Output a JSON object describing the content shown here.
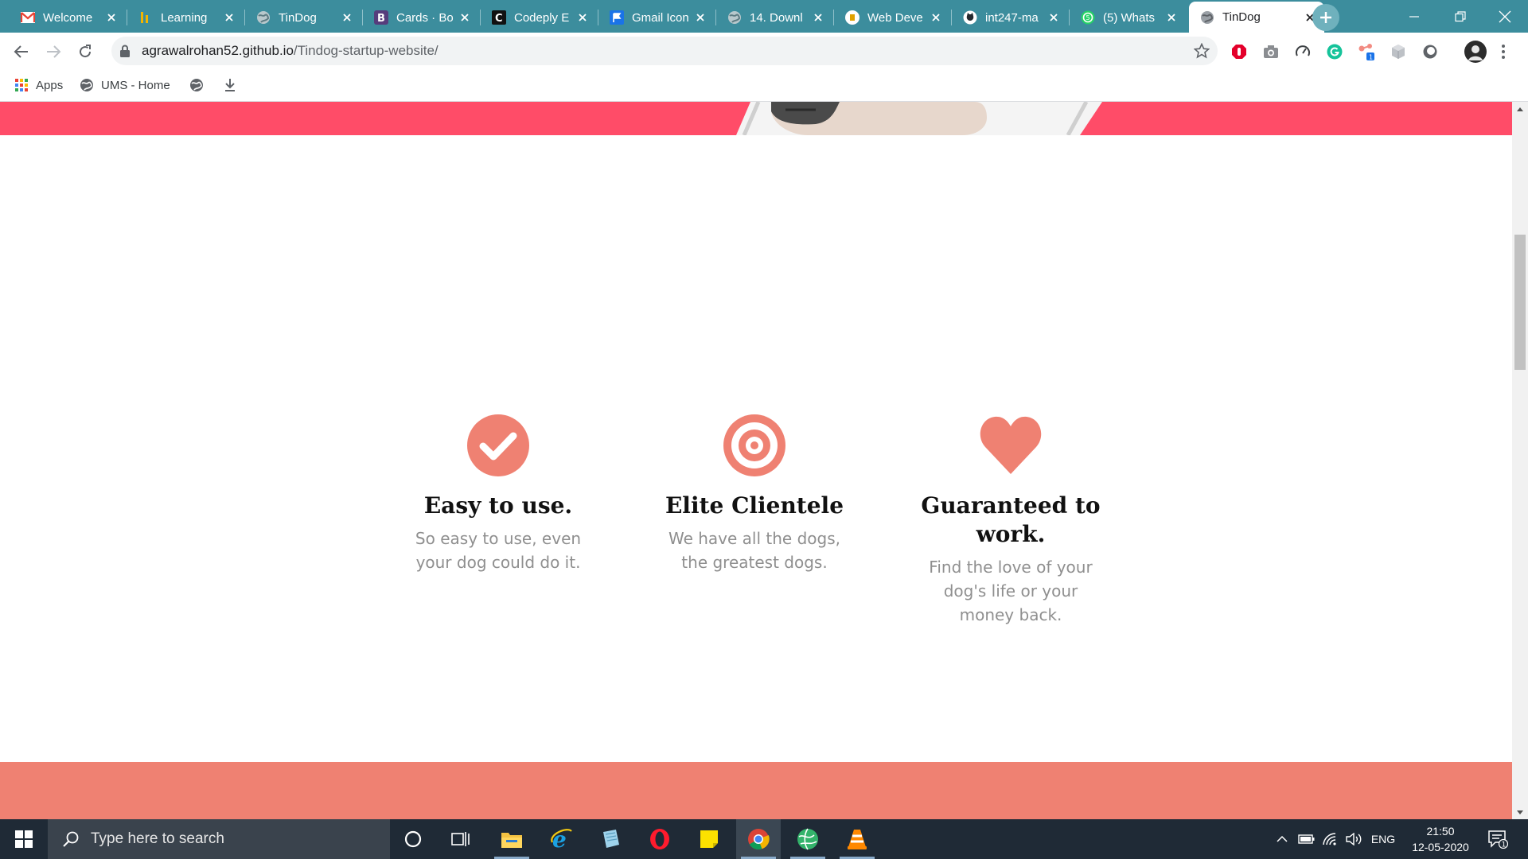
{
  "browser": {
    "tabs": [
      {
        "title": "Welcome",
        "favicon": "gmail-icon"
      },
      {
        "title": "Learning",
        "favicon": "learning-icon"
      },
      {
        "title": "TinDog",
        "favicon": "globe-icon"
      },
      {
        "title": "Cards · Bo",
        "favicon": "bootstrap-icon"
      },
      {
        "title": "Codeply E",
        "favicon": "codeply-icon"
      },
      {
        "title": "Gmail Icon",
        "favicon": "flag-icon"
      },
      {
        "title": "14. Downl",
        "favicon": "globe-icon"
      },
      {
        "title": "Web Deve",
        "favicon": "web-dev-icon"
      },
      {
        "title": "int247-ma",
        "favicon": "github-icon"
      },
      {
        "title": "(5) Whats",
        "favicon": "whatsapp-icon"
      },
      {
        "title": "TinDog",
        "favicon": "globe-icon",
        "active": true
      }
    ],
    "url_host": "agrawalrohan52.github.io",
    "url_path": "/Tindog-startup-website/",
    "bookmarks": [
      {
        "label": "Apps",
        "icon": "apps-grid-icon"
      },
      {
        "label": "UMS - Home",
        "icon": "globe-icon"
      },
      {
        "label": "",
        "icon": "globe-icon"
      },
      {
        "label": "",
        "icon": "download-icon"
      }
    ]
  },
  "page": {
    "features": [
      {
        "icon": "check-circle-icon",
        "title": "Easy to use.",
        "text": "So easy to use, even your dog could do it."
      },
      {
        "icon": "bullseye-icon",
        "title": "Elite Clientele",
        "text": "We have all the dogs, the greatest dogs."
      },
      {
        "icon": "heart-icon",
        "title": "Guaranteed to work.",
        "text": "Find the love of your dog's life or your money back."
      }
    ],
    "colors": {
      "hero": "#ff4c68",
      "feature_icon": "#ef8172",
      "testimonial": "#ef8172"
    }
  },
  "taskbar": {
    "search_placeholder": "Type here to search",
    "language": "ENG",
    "time": "21:50",
    "date": "12-05-2020",
    "notification_count": "1"
  }
}
